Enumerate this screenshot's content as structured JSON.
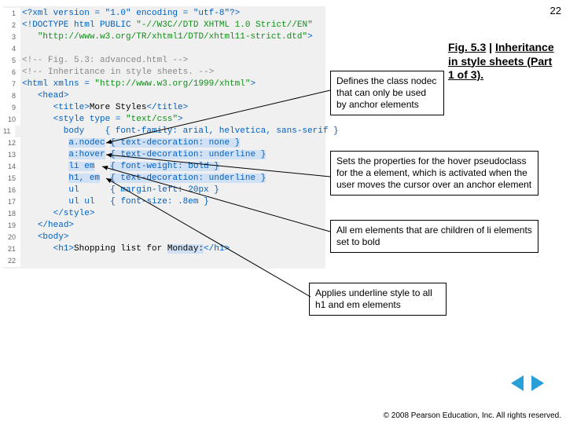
{
  "page_number": "22",
  "code": {
    "l1": "<?xml version = \"1.0\" encoding = \"utf-8\"?>",
    "l2a": "<!DOCTYPE html PUBLIC ",
    "l2b": "\"-//W3C//DTD XHTML 1.0 Strict//EN\"",
    "l3": "\"http://www.w3.org/TR/xhtml1/DTD/xhtml11-strict.dtd\"",
    "l3_end": ">",
    "l5": "<!-- Fig. 5.3: advanced.html -->",
    "l6": "<!-- Inheritance in style sheets. -->",
    "l7a": "<html xmlns = ",
    "l7b": "\"http://www.w3.org/1999/xhtml\"",
    "l7c": ">",
    "l8": "<head>",
    "l9a": "<title>",
    "l9b": "More Styles",
    "l9c": "</title>",
    "l10a": "<style type = ",
    "l10b": "\"text/css\"",
    "l10c": ">",
    "l11a": "body",
    "l11b": "{ font-family: arial, helvetica, sans-serif }",
    "l12a": "a.nodec",
    "l12b": "{ text-decoration: none }",
    "l13a": "a:hover",
    "l13b": "{ text-decoration: underline }",
    "l14a": "li em",
    "l14b": "{ font-weight: bold }",
    "l15a": "h1, em",
    "l15b": "{ text-decoration: underline }",
    "l16a": "ul",
    "l16b": "{ margin-left: 20px }",
    "l17a": "ul ul",
    "l17b": "{ font-size: .8em }",
    "l18": "</style>",
    "l19": "</head>",
    "l20": "<body>",
    "l21a": "<h1>",
    "l21b": "Shopping list for ",
    "l21c": "Monday:",
    "l21d": "</h1>"
  },
  "callouts": {
    "c1": "Defines the class nodec that can only be used by anchor elements",
    "c2": "Sets the properties for the hover pseudoclass for the a element, which is activated when the user moves the cursor over an anchor element",
    "c3": "All em elements that are children of li elements set to bold",
    "c4": "Applies underline style to all h1 and em elements"
  },
  "figure": {
    "num": "Fig. 5.3",
    "pipe": " | ",
    "text": "Inheritance in style sheets (Part 1 of 3)."
  },
  "copyright": "© 2008 Pearson Education, Inc. All rights reserved."
}
